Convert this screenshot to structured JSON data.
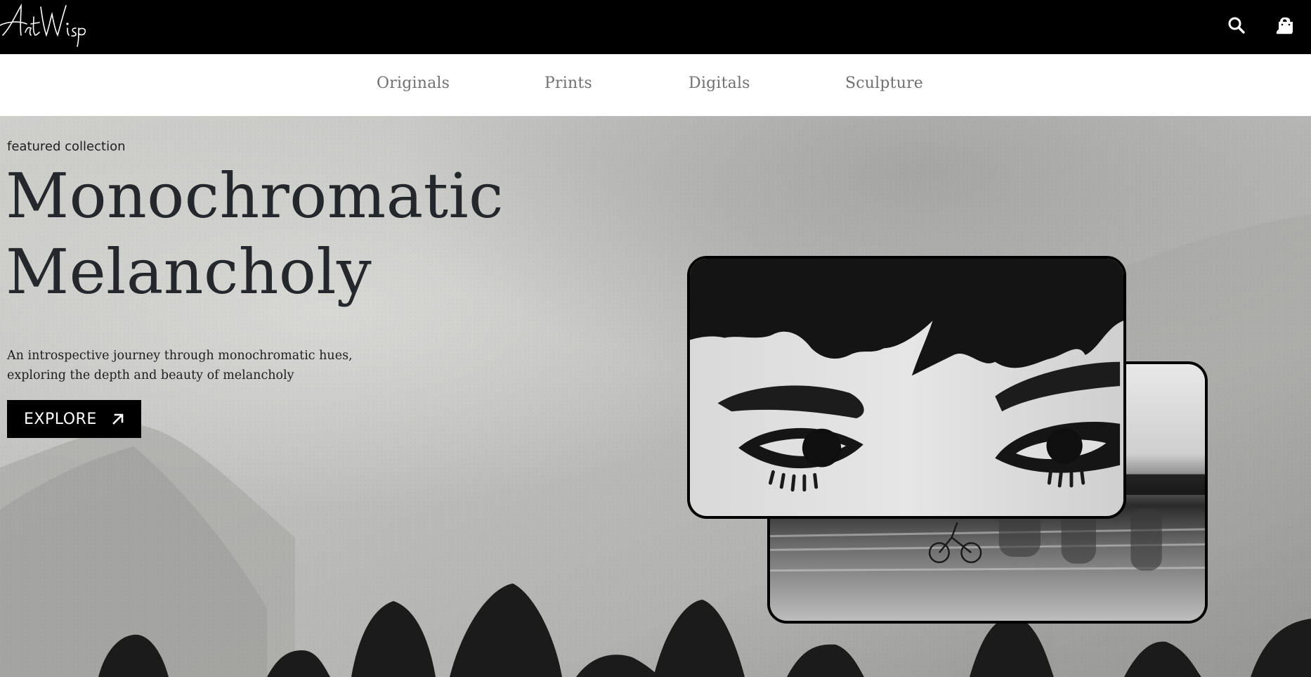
{
  "brand": {
    "logo_text": "ArtWisp"
  },
  "header": {
    "icons": [
      {
        "name": "search-icon"
      },
      {
        "name": "user-icon"
      },
      {
        "name": "shopping-bag-icon"
      }
    ]
  },
  "nav": {
    "items": [
      {
        "label": "Originals"
      },
      {
        "label": "Prints"
      },
      {
        "label": "Digitals"
      },
      {
        "label": "Sculpture"
      }
    ]
  },
  "hero": {
    "eyebrow": "featured collection",
    "title_line1": "Monochromatic",
    "title_line2": "Melancholy",
    "description": "An introspective journey through monochromatic hues, exploring the depth and beauty of melancholy",
    "cta_label": "EXPLORE",
    "cta_icon": "arrow-up-right-icon"
  },
  "colors": {
    "header_bg": "#000000",
    "nav_text": "#707070",
    "title_text": "#24272b",
    "button_bg": "#000000",
    "button_text": "#ffffff"
  }
}
